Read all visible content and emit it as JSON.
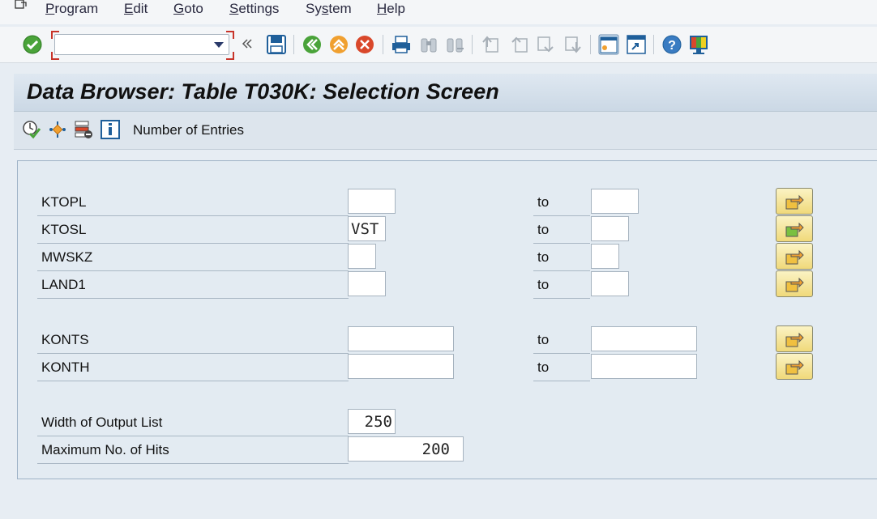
{
  "menu": {
    "items": [
      {
        "name": "menu-program",
        "pre": "",
        "ul": "P",
        "post": "rogram"
      },
      {
        "name": "menu-edit",
        "pre": "",
        "ul": "E",
        "post": "dit"
      },
      {
        "name": "menu-goto",
        "pre": "",
        "ul": "G",
        "post": "oto"
      },
      {
        "name": "menu-settings",
        "pre": "",
        "ul": "S",
        "post": "ettings"
      },
      {
        "name": "menu-system",
        "pre": "Sy",
        "ul": "s",
        "post": "tem"
      },
      {
        "name": "menu-help",
        "pre": "",
        "ul": "H",
        "post": "elp"
      }
    ]
  },
  "toolbar": {
    "command_field_value": "",
    "icons": [
      "enter-icon",
      "back-icon",
      "save-icon",
      "back-green-icon",
      "exit-icon",
      "cancel-icon",
      "print-icon",
      "find-icon",
      "find-next-icon",
      "first-page-icon",
      "previous-page-icon",
      "next-page-icon",
      "last-page-icon",
      "new-session-icon",
      "shortcut-icon",
      "help-icon",
      "customize-layout-icon"
    ]
  },
  "title": "Data Browser: Table T030K: Selection Screen",
  "app_toolbar": {
    "number_of_entries_label": "Number of Entries"
  },
  "fields": {
    "ktopl": {
      "label": "KTOPL",
      "from": "",
      "to_label": "to",
      "to": ""
    },
    "ktosl": {
      "label": "KTOSL",
      "from": "VST",
      "to_label": "to",
      "to": ""
    },
    "mwskz": {
      "label": "MWSKZ",
      "from": "",
      "to_label": "to",
      "to": ""
    },
    "land1": {
      "label": "LAND1",
      "from": "",
      "to_label": "to",
      "to": ""
    },
    "konts": {
      "label": "KONTS",
      "from": "",
      "to_label": "to",
      "to": ""
    },
    "konth": {
      "label": "KONTH",
      "from": "",
      "to_label": "to",
      "to": ""
    }
  },
  "settings": {
    "width_label": "Width of Output List",
    "width_value": "250",
    "max_hits_label": "Maximum No. of Hits",
    "max_hits_value": "200"
  },
  "colors": {
    "accent_green": "#4aa33a",
    "accent_orange": "#f0a030",
    "accent_red": "#d9482b",
    "brand_blue": "#1f5f9a",
    "multi_select_yellow": "#f0d97a"
  }
}
